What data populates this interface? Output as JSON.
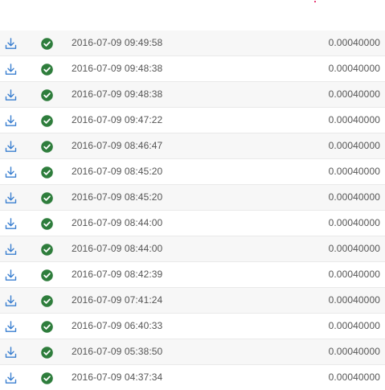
{
  "colors": {
    "download_icon": "#3a7fd0",
    "status_icon": "#2e7d3c",
    "row_alt": "#f7f7f7",
    "text": "#555555",
    "accent_dot": "#e0004d"
  },
  "transactions": [
    {
      "icon": "download-icon",
      "status": "check-circle-icon",
      "date": "2016-07-09 09:49:58",
      "amount": "0.00040000"
    },
    {
      "icon": "download-icon",
      "status": "check-circle-icon",
      "date": "2016-07-09 09:48:38",
      "amount": "0.00040000"
    },
    {
      "icon": "download-icon",
      "status": "check-circle-icon",
      "date": "2016-07-09 09:48:38",
      "amount": "0.00040000"
    },
    {
      "icon": "download-icon",
      "status": "check-circle-icon",
      "date": "2016-07-09 09:47:22",
      "amount": "0.00040000"
    },
    {
      "icon": "download-icon",
      "status": "check-circle-icon",
      "date": "2016-07-09 08:46:47",
      "amount": "0.00040000"
    },
    {
      "icon": "download-icon",
      "status": "check-circle-icon",
      "date": "2016-07-09 08:45:20",
      "amount": "0.00040000"
    },
    {
      "icon": "download-icon",
      "status": "check-circle-icon",
      "date": "2016-07-09 08:45:20",
      "amount": "0.00040000"
    },
    {
      "icon": "download-icon",
      "status": "check-circle-icon",
      "date": "2016-07-09 08:44:00",
      "amount": "0.00040000"
    },
    {
      "icon": "download-icon",
      "status": "check-circle-icon",
      "date": "2016-07-09 08:44:00",
      "amount": "0.00040000"
    },
    {
      "icon": "download-icon",
      "status": "check-circle-icon",
      "date": "2016-07-09 08:42:39",
      "amount": "0.00040000"
    },
    {
      "icon": "download-icon",
      "status": "check-circle-icon",
      "date": "2016-07-09 07:41:24",
      "amount": "0.00040000"
    },
    {
      "icon": "download-icon",
      "status": "check-circle-icon",
      "date": "2016-07-09 06:40:33",
      "amount": "0.00040000"
    },
    {
      "icon": "download-icon",
      "status": "check-circle-icon",
      "date": "2016-07-09 05:38:50",
      "amount": "0.00040000"
    },
    {
      "icon": "download-icon",
      "status": "check-circle-icon",
      "date": "2016-07-09 04:37:34",
      "amount": "0.00040000"
    }
  ]
}
